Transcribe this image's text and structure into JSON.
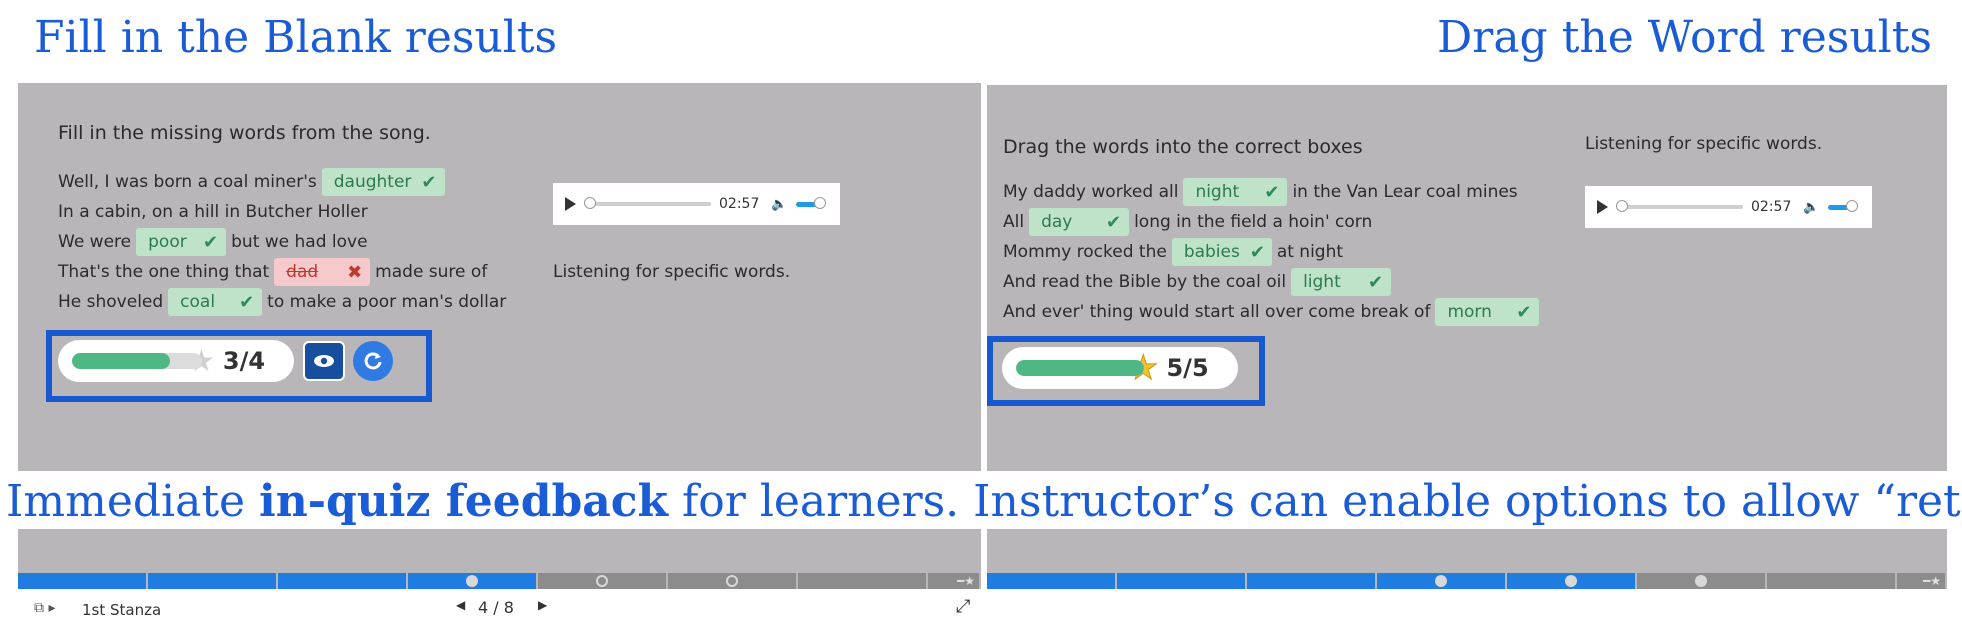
{
  "titles": {
    "left": "Fill in the Blank results",
    "right": "Drag the Word results"
  },
  "banner": {
    "pre": "Immediate ",
    "bold": "in-quiz feedback",
    "post": " for learners. Instructor’s can enable options to allow “retry”."
  },
  "left_quiz": {
    "instruction": "Fill in the missing words from the song.",
    "lines": [
      {
        "before": "Well, I was born a coal miner's",
        "answer": "daughter",
        "status": "correct",
        "after": ""
      },
      {
        "before": "In a cabin, on a hill in Butcher Holler",
        "answer": "",
        "status": "",
        "after": ""
      },
      {
        "before": "We were",
        "answer": "poor",
        "status": "correct",
        "after": "but we had love"
      },
      {
        "before": "That's the one thing that",
        "answer": "dad",
        "status": "incorrect",
        "after": "made sure of"
      },
      {
        "before": "He shoveled",
        "answer": "coal",
        "status": "correct",
        "after": "to make a poor man's dollar"
      }
    ],
    "audio": {
      "time": "02:57",
      "progress": 0.0,
      "volume": 0.8
    },
    "hint": "Listening for specific words.",
    "score": {
      "text": "3/4",
      "progress": 0.75,
      "star": "star-outline"
    }
  },
  "right_quiz": {
    "instruction": "Drag the words into the correct boxes",
    "lines": [
      {
        "before": "My daddy worked all",
        "answer": "night",
        "status": "correct",
        "after": "in the Van Lear coal mines"
      },
      {
        "before": "All",
        "answer": "day",
        "status": "correct",
        "after": "long in the field a hoin' corn"
      },
      {
        "before": "Mommy rocked the",
        "answer": "babies",
        "status": "correct",
        "after": "at night"
      },
      {
        "before": "And read the Bible by the coal oil",
        "answer": "light",
        "status": "correct",
        "after": ""
      },
      {
        "before": "And ever' thing would start all over come break of",
        "answer": "morn",
        "status": "correct",
        "after": ""
      }
    ],
    "audio": {
      "time": "02:57",
      "progress": 0.0,
      "volume": 0.8
    },
    "hint": "Listening for specific words.",
    "score": {
      "text": "5/5",
      "progress": 1.0,
      "star": "star-filled"
    }
  },
  "left_nav": {
    "segments": [
      "done",
      "done",
      "done",
      "done-current",
      "todo",
      "todo",
      "todo",
      "end"
    ]
  },
  "right_nav": {
    "segments": [
      "done",
      "done",
      "done",
      "done-current",
      "done-current",
      "todo",
      "todo",
      "end"
    ]
  },
  "footer": {
    "stanza": "1st Stanza",
    "page": "4 / 8"
  },
  "colors": {
    "accent": "#1a5bd6",
    "panel": "#b8b6b8",
    "correct": "#bfe3c9",
    "incorrect": "#f6c9cc",
    "progress": "#4db883"
  }
}
